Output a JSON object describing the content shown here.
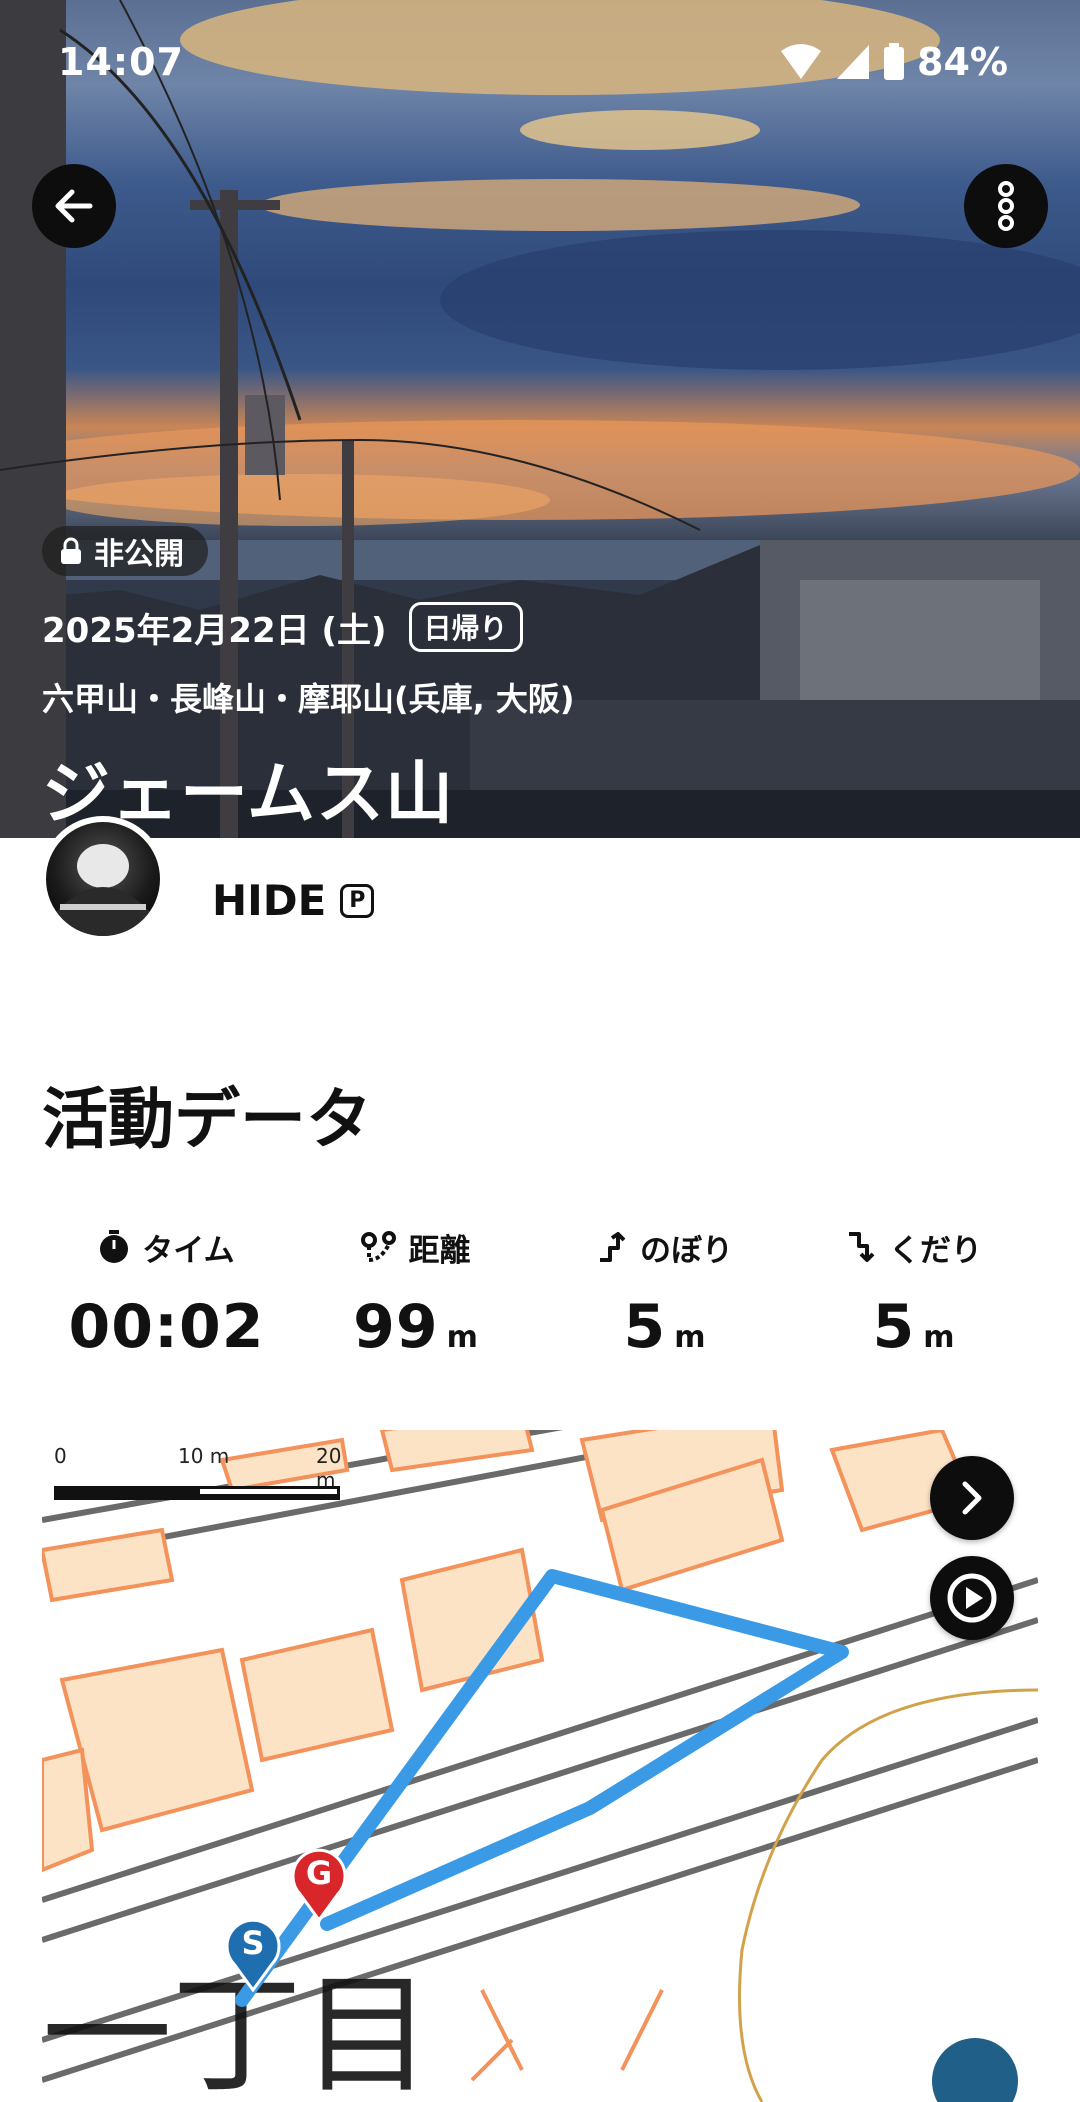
{
  "status_bar": {
    "time": "14:07",
    "battery": "84%"
  },
  "hero": {
    "privacy": "非公開",
    "date": "2025年2月22日 (土)",
    "trip_type": "日帰り",
    "area": "六甲山・長峰山・摩耶山(兵庫, 大阪)",
    "title": "ジェームス山"
  },
  "user": {
    "name": "HIDE",
    "badge": "P"
  },
  "activity": {
    "section_title": "活動データ",
    "stats": [
      {
        "label": "タイム",
        "icon": "stopwatch-icon",
        "value": "00:02",
        "unit": ""
      },
      {
        "label": "距離",
        "icon": "route-distance-icon",
        "value": "99",
        "unit": "m"
      },
      {
        "label": "のぼり",
        "icon": "ascent-icon",
        "value": "5",
        "unit": "m"
      },
      {
        "label": "くだり",
        "icon": "descent-icon",
        "value": "5",
        "unit": "m"
      }
    ]
  },
  "map": {
    "scale_labels": [
      "0",
      "10 m",
      "20 m"
    ],
    "start_pin": "S",
    "goal_pin": "G",
    "route_color": "#3a9ae6",
    "map_text": "一丁目"
  },
  "colors": {
    "accent_dark": "#0d0d0d",
    "building_fill": "#fde3c6",
    "building_stroke": "#f3925a"
  }
}
